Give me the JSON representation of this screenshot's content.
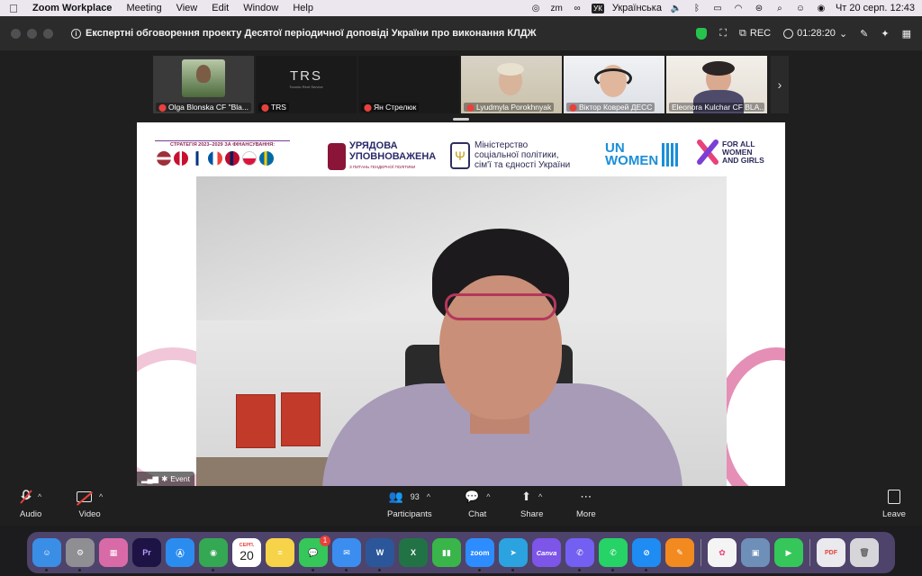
{
  "menubar": {
    "app_name": "Zoom Workplace",
    "menus": [
      "Meeting",
      "View",
      "Edit",
      "Window",
      "Help"
    ],
    "language": "Українська",
    "lang_code": "УК",
    "datetime": "Чт 20 серп.  12:43"
  },
  "window": {
    "title": "Експертні обговорення проекту Десятої періодичної доповіді України про виконання КЛДЖ",
    "rec_label": "REC",
    "timer": "01:28:20",
    "colors": {
      "secure": "#27c24c",
      "mic_muted": "#e8413c"
    }
  },
  "gallery": {
    "tiles": [
      {
        "name": "Olga Blonska CF \"Bla...",
        "muted": true
      },
      {
        "name": "TRS",
        "muted": true,
        "logo_text": "TRS",
        "logo_sub": "Toronto Rent Service"
      },
      {
        "name": "Ян Стрелюк",
        "muted": true
      },
      {
        "name": "Lyudmyla Porokhnyak",
        "muted": true
      },
      {
        "name": "Віктор Коврей ДЕСС",
        "muted": true
      },
      {
        "name": "Eleonora Kulchar CF BLA...",
        "muted": false
      }
    ]
  },
  "stage": {
    "badge_label": "Event",
    "logos": {
      "strategy": "СТРАТЕГІЯ 2023–2029 ЗА ФІНАНСУВАННЯ:",
      "upov_line1": "УРЯДОВА",
      "upov_line2": "УПОВНОВАЖЕНА",
      "upov_sub": "З ПИТАНЬ ГЕНДЕРНОЇ ПОЛІТИКИ",
      "ministry_line1": "Міністерство",
      "ministry_line2": "соціальної політики,",
      "ministry_line3": "сім'ї та єдності України",
      "unwomen_line1": "UN",
      "unwomen_line2": "WOMEN",
      "forall_line1": "FOR ALL",
      "forall_line2": "WOMEN",
      "forall_line3": "AND GIRLS"
    }
  },
  "controls": {
    "audio": "Audio",
    "video": "Video",
    "participants": "Participants",
    "participants_count": "93",
    "chat": "Chat",
    "share": "Share",
    "more": "More",
    "leave": "Leave"
  },
  "dock": {
    "apps": [
      {
        "name": "Finder",
        "color": "#3a8ee6"
      },
      {
        "name": "System Settings",
        "color": "#8e8e93"
      },
      {
        "name": "Launchpad",
        "color": "#d96aa8"
      },
      {
        "name": "Premiere Pro",
        "color": "#1d1345",
        "label": "Pr"
      },
      {
        "name": "App Store",
        "color": "#2b8cf0"
      },
      {
        "name": "Chrome",
        "color": "#34a853"
      },
      {
        "name": "Calendar",
        "color": "#ffffff",
        "month": "СЕРП.",
        "day": "20"
      },
      {
        "name": "Notes",
        "color": "#f7d34a"
      },
      {
        "name": "Messages",
        "color": "#35c759",
        "badge": "1"
      },
      {
        "name": "Mail",
        "color": "#3b8ef0"
      },
      {
        "name": "Word",
        "color": "#2b579a",
        "label": "W"
      },
      {
        "name": "Excel",
        "color": "#217346",
        "label": "X"
      },
      {
        "name": "Numbers",
        "color": "#39b54a"
      },
      {
        "name": "Zoom",
        "color": "#2d8cff",
        "label": "zoom"
      },
      {
        "name": "Telegram",
        "color": "#2aa3e0"
      },
      {
        "name": "Canva",
        "color": "#7d55e8",
        "label": "Canva"
      },
      {
        "name": "Viber",
        "color": "#7360f2"
      },
      {
        "name": "WhatsApp",
        "color": "#25d366"
      },
      {
        "name": "Safari",
        "color": "#1e8cf2"
      },
      {
        "name": "Pages",
        "color": "#f28a1f"
      },
      {
        "name": "Photos",
        "color": "#f4f4f4"
      },
      {
        "name": "Preview",
        "color": "#6d8fb8"
      },
      {
        "name": "FaceTime",
        "color": "#35c759"
      },
      {
        "name": "PDF file",
        "color": "#e9e9ee"
      },
      {
        "name": "Trash",
        "color": "#d6d6da"
      }
    ]
  }
}
